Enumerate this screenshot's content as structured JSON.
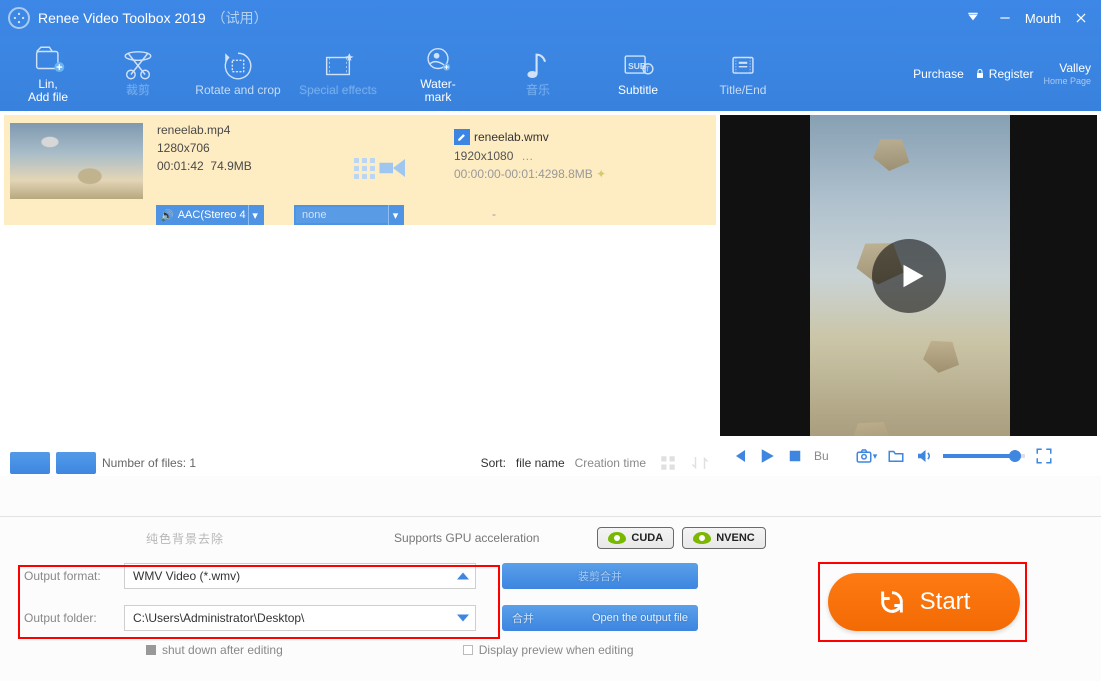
{
  "title": {
    "app": "Renee Video Toolbox 2019",
    "trial": "（试用）",
    "mouth": "Mouth"
  },
  "toolbar": {
    "addfile_line1": "Lin,",
    "addfile_line2": "Add file",
    "cut": "裁剪",
    "rotate": "Rotate and crop",
    "effects": "Special effects",
    "water1": "Water-",
    "water2": "mark",
    "music": "音乐",
    "subtitle": "Subtitle",
    "titleend": "Title/End",
    "purchase": "Purchase",
    "register": "Register",
    "valley": "Valley",
    "homepage": "Home Page"
  },
  "file": {
    "in_name": "reneelab.mp4",
    "in_res": "1280x706",
    "in_dur": "00:01:42",
    "in_size": "74.9MB",
    "out_name": "reneelab.wmv",
    "out_res": "1920x1080",
    "out_time_size": "00:00:00-00:01:4298.8MB",
    "more": "…",
    "audio_label": "AAC(Stereo 4",
    "sub_label": "none",
    "dash": "-"
  },
  "list": {
    "count": "Number of files: 1",
    "sort": "Sort:",
    "by_name": "file name",
    "by_time": "Creation time",
    "btn1": " ",
    "btn2": " "
  },
  "preview": {
    "bu": "Bu"
  },
  "gpu": {
    "blur": "纯色背景去除",
    "supports": "Supports GPU acceleration",
    "cuda": "CUDA",
    "nvenc": "NVENC"
  },
  "output": {
    "fmt_label": "Output format:",
    "fmt_value": "WMV Video (*.wmv)",
    "fld_label": "Output folder:",
    "fld_value": "C:\\Users\\Administrator\\Desktop\\",
    "midbtn1": "装剪合并",
    "midbtn2_left": "合并",
    "midbtn2_right": "Open the output file"
  },
  "start": "Start",
  "checks": {
    "shutdown": "shut down after editing",
    "preview": "Display preview when editing"
  }
}
